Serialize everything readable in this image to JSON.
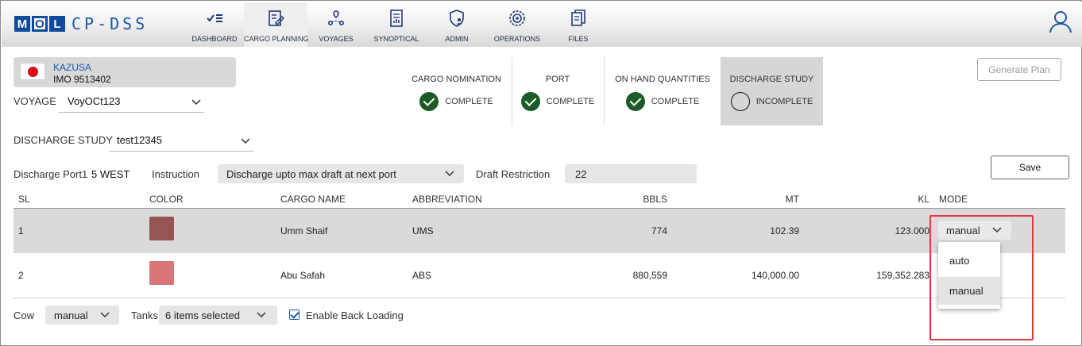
{
  "app": {
    "logo_letters": [
      "M",
      "O",
      "L"
    ],
    "name": "CP-DSS",
    "brand_color": "#1d57a8"
  },
  "nav": [
    {
      "label": "DASHBOARD",
      "icon": "dashboard-checklist-icon"
    },
    {
      "label": "CARGO PLANNING",
      "icon": "cargo-planning-icon",
      "active": true
    },
    {
      "label": "VOYAGES",
      "icon": "voyages-route-icon"
    },
    {
      "label": "SYNOPTICAL",
      "icon": "synoptical-doc-icon"
    },
    {
      "label": "ADMIN",
      "icon": "admin-shield-icon"
    },
    {
      "label": "OPERATIONS",
      "icon": "operations-gear-icon"
    },
    {
      "label": "FILES",
      "icon": "files-icon"
    }
  ],
  "vessel": {
    "name": "KAZUSA",
    "imo": "IMO 9513402",
    "flag": "japan-flag-icon"
  },
  "voyage": {
    "label": "VOYAGE",
    "value": "VoyOCt123"
  },
  "steps": [
    {
      "title": "CARGO NOMINATION",
      "status": "COMPLETE"
    },
    {
      "title": "PORT",
      "status": "COMPLETE"
    },
    {
      "title": "ON HAND QUANTITIES",
      "status": "COMPLETE"
    },
    {
      "title": "DISCHARGE STUDY",
      "status": "INCOMPLETE"
    }
  ],
  "generate_plan_label": "Generate Plan",
  "discharge_study": {
    "label": "DISCHARGE STUDY",
    "value": "test12345"
  },
  "port_bar": {
    "port_label": "Discharge Port1",
    "port_value": "5 WEST",
    "instruction_label": "Instruction",
    "instruction_value": "Discharge upto max draft at next port",
    "draft_label": "Draft Restriction",
    "draft_value": "22",
    "save_label": "Save"
  },
  "table": {
    "headers": [
      "SL",
      "COLOR",
      "CARGO NAME",
      "ABBREVIATION",
      "BBLS",
      "MT",
      "KL",
      "MODE"
    ],
    "rows": [
      {
        "sl": "1",
        "color": "#945553",
        "cargo": "Umm Shaif",
        "abbr": "UMS",
        "bbls": "774",
        "mt": "102.39",
        "kl": "123.000",
        "mode": "manual"
      },
      {
        "sl": "2",
        "color": "#d87578",
        "cargo": "Abu Safah",
        "abbr": "ABS",
        "bbls": "880,559",
        "mt": "140,000.00",
        "kl": "159,352.283",
        "mode": ""
      }
    ]
  },
  "mode_dropdown": {
    "options": [
      "auto",
      "manual"
    ],
    "selected": "manual"
  },
  "footer": {
    "cow_label": "Cow",
    "cow_value": "manual",
    "tanks_label": "Tanks",
    "tanks_value": "6 items selected",
    "backloading_label": "Enable Back Loading",
    "backloading_checked": true
  }
}
